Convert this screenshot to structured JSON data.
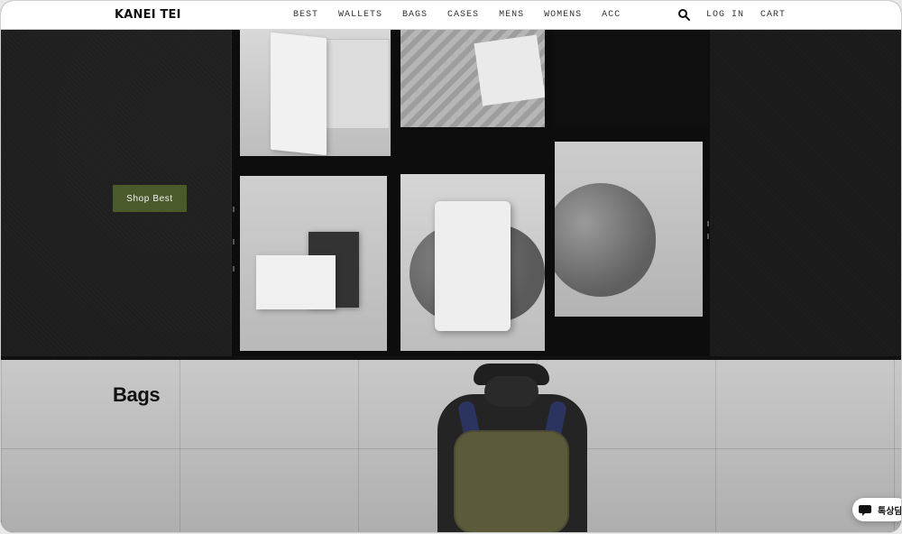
{
  "header": {
    "logo": "KANEI TEI",
    "nav": [
      "BEST",
      "WALLETS",
      "BAGS",
      "CASES",
      "MENS",
      "WOMENS",
      "ACC"
    ],
    "utilities": {
      "login": "LOG IN",
      "cart": "CART"
    },
    "icons": {
      "search": "search-icon"
    }
  },
  "hero": {
    "cta": "Shop Best"
  },
  "bags": {
    "title": "Bags"
  },
  "chat": {
    "label": "톡상담",
    "icon": "chat-bubble-icon"
  },
  "colors": {
    "cta_bg": "#4a5a2b",
    "header_bg": "#ffffff"
  }
}
